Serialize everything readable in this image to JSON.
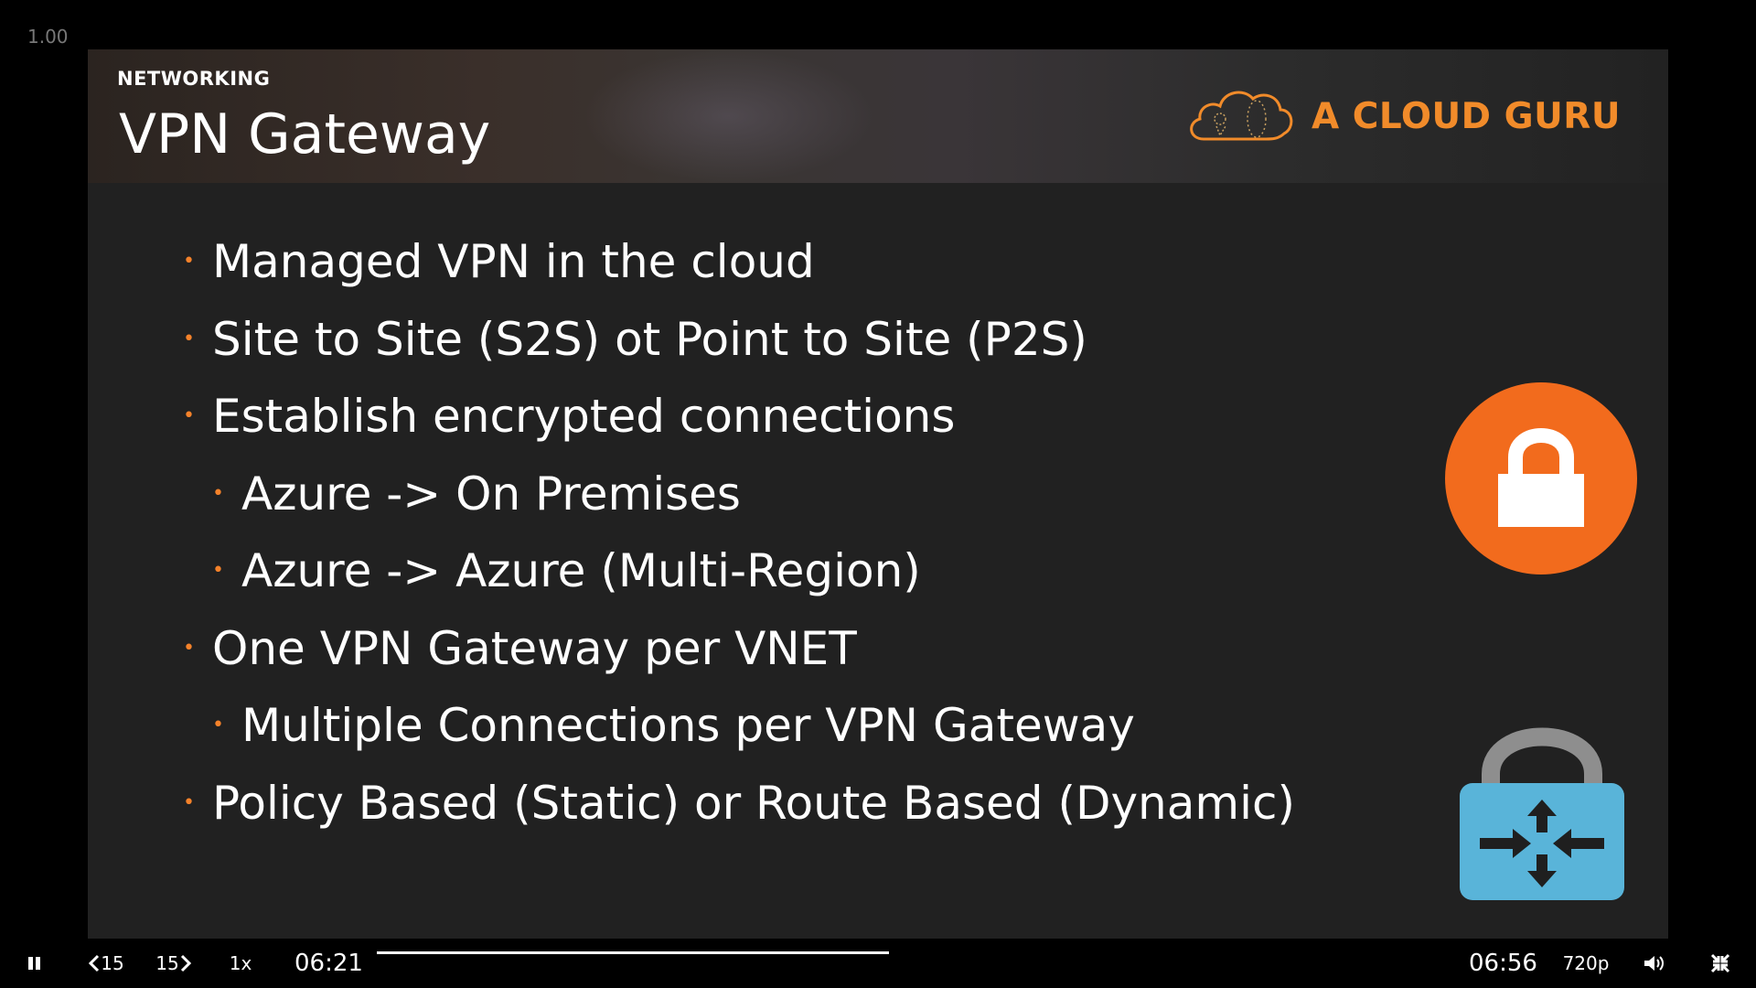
{
  "player": {
    "zoom_level": "1.00",
    "current_time": "06:21",
    "total_time": "06:56",
    "progress": 1.0,
    "speed_label": "1x",
    "quality_label": "720p",
    "rewind_label": "15",
    "forward_label": "15",
    "icons": {
      "play_pause": "pause-icon",
      "rewind": "rewind-15-icon",
      "forward": "forward-15-icon",
      "volume": "volume-icon",
      "fullscreen": "exit-fullscreen-icon"
    }
  },
  "slide": {
    "section_label": "NETWORKING",
    "title": "VPN Gateway",
    "brand_name": "A CLOUD GURU",
    "bullets": [
      {
        "text": "Managed VPN in the cloud",
        "level": 1
      },
      {
        "text": "Site to Site (S2S) ot Point to Site (P2S)",
        "level": 1
      },
      {
        "text": "Establish encrypted connections",
        "level": 1
      },
      {
        "text": "Azure -> On Premises",
        "level": 2
      },
      {
        "text": "Azure -> Azure (Multi-Region)",
        "level": 2
      },
      {
        "text": "One VPN Gateway per VNET",
        "level": 1
      },
      {
        "text": "Multiple Connections per VPN Gateway",
        "level": 2
      },
      {
        "text": "Policy Based (Static) or Route Based (Dynamic)",
        "level": 1
      }
    ],
    "icons": {
      "logo": "cloud-logo-icon",
      "lock": "lock-icon",
      "gateway": "vpn-gateway-icon"
    },
    "colors": {
      "accent": "#f5822a",
      "lock_circle": "#f26b1d",
      "gateway_body": "#59b4d9",
      "background": "#212121"
    }
  }
}
